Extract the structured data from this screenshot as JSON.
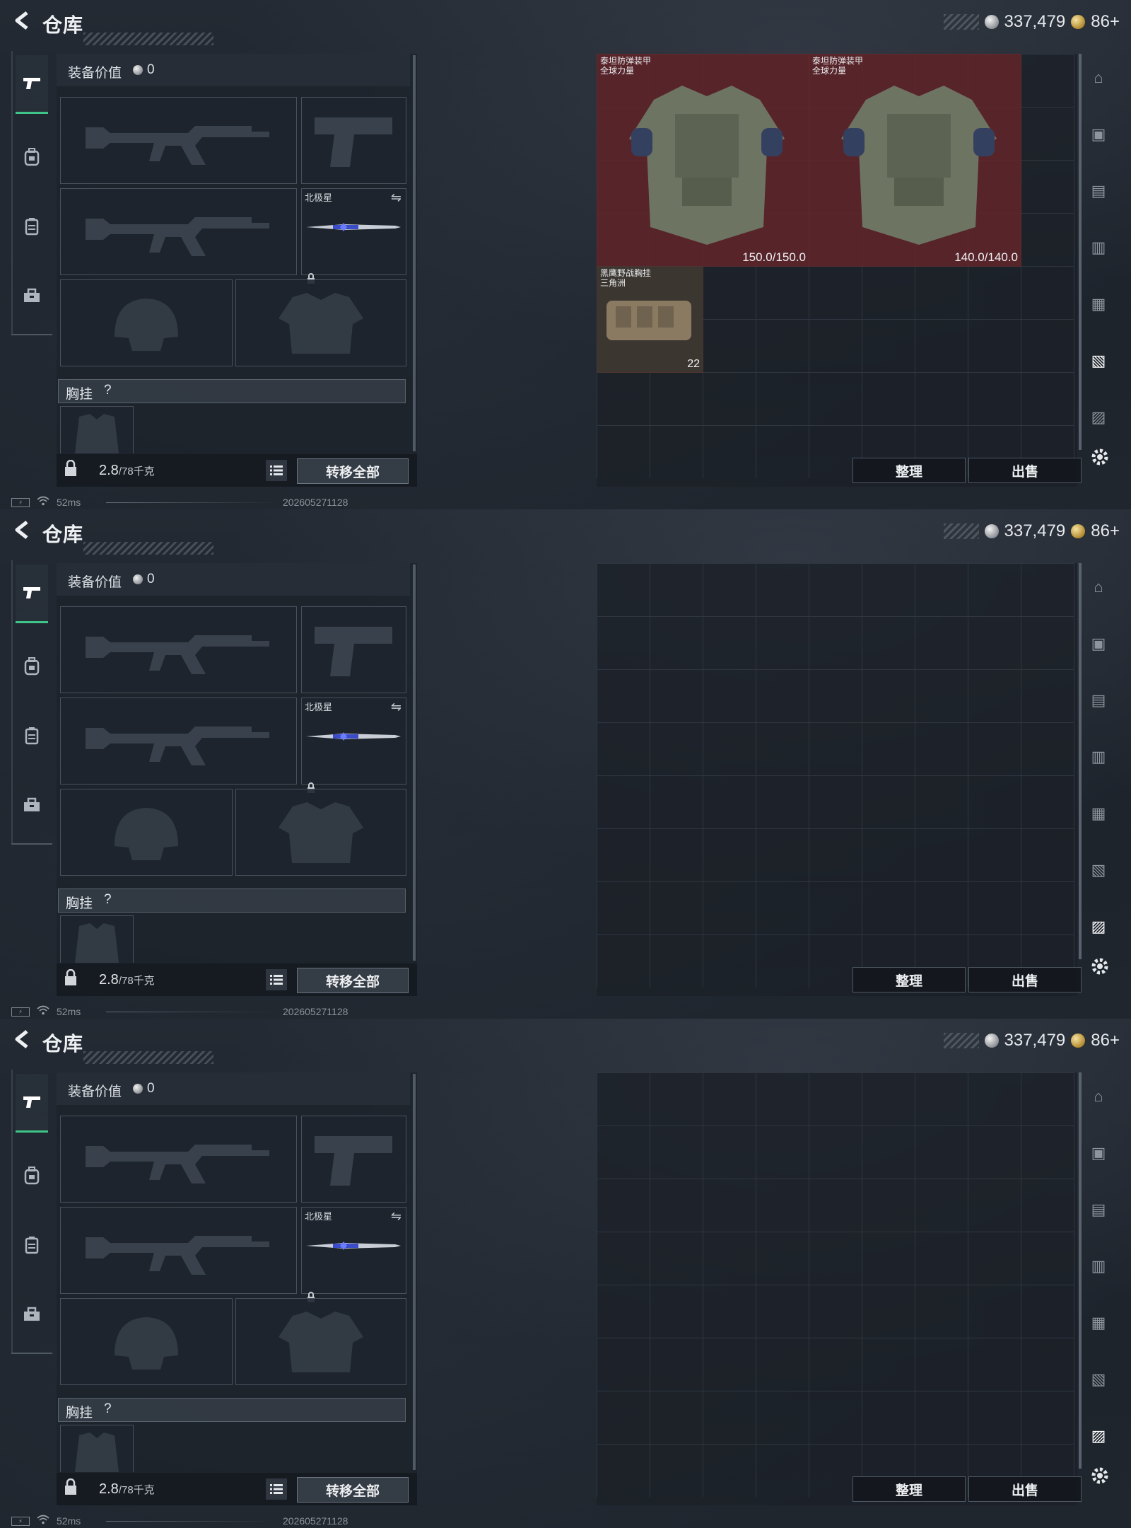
{
  "header": {
    "back_icon": "chevron-left-icon",
    "title": "仓库",
    "silver_amount": "337,479",
    "gold_amount": "86+",
    "silver_icon": "silver-coin-icon",
    "gold_icon": "gold-coin-icon"
  },
  "equipment": {
    "value_label": "装备价值",
    "value_amount": "0",
    "knife_name": "北极星",
    "chest_rig_label": "胸挂",
    "chest_rig_help": "?",
    "weight_current": "2.8",
    "weight_max": "/78千克",
    "transfer_all": "转移全部"
  },
  "grid_buttons": {
    "sort": "整理",
    "sell": "出售"
  },
  "status": {
    "ping": "52ms",
    "timestamp": "202605271128"
  },
  "screens": [
    {
      "items": [
        {
          "name": "泰坦防弹装甲",
          "subtitle": "全球力量",
          "durability": "150.0/150.0"
        },
        {
          "name": "泰坦防弹装甲",
          "subtitle": "全球力量",
          "durability": "140.0/140.0"
        },
        {
          "name": "黑鹰野战胸挂",
          "subtitle": "三角洲",
          "capacity": "22"
        }
      ],
      "active_filter": 5
    },
    {
      "items": [],
      "active_filter": 6
    },
    {
      "items": [],
      "active_filter": 6
    }
  ],
  "filters": [
    "helmet-icon",
    "armor-filter-icon",
    "tier4-rig-icon",
    "tier2-rig-icon",
    "tier4-vest-icon",
    "armor-vest-icon",
    "tier4-backpack-icon"
  ],
  "colors": {
    "accent_green": "#3fc48a",
    "item_red": "#62242a"
  }
}
